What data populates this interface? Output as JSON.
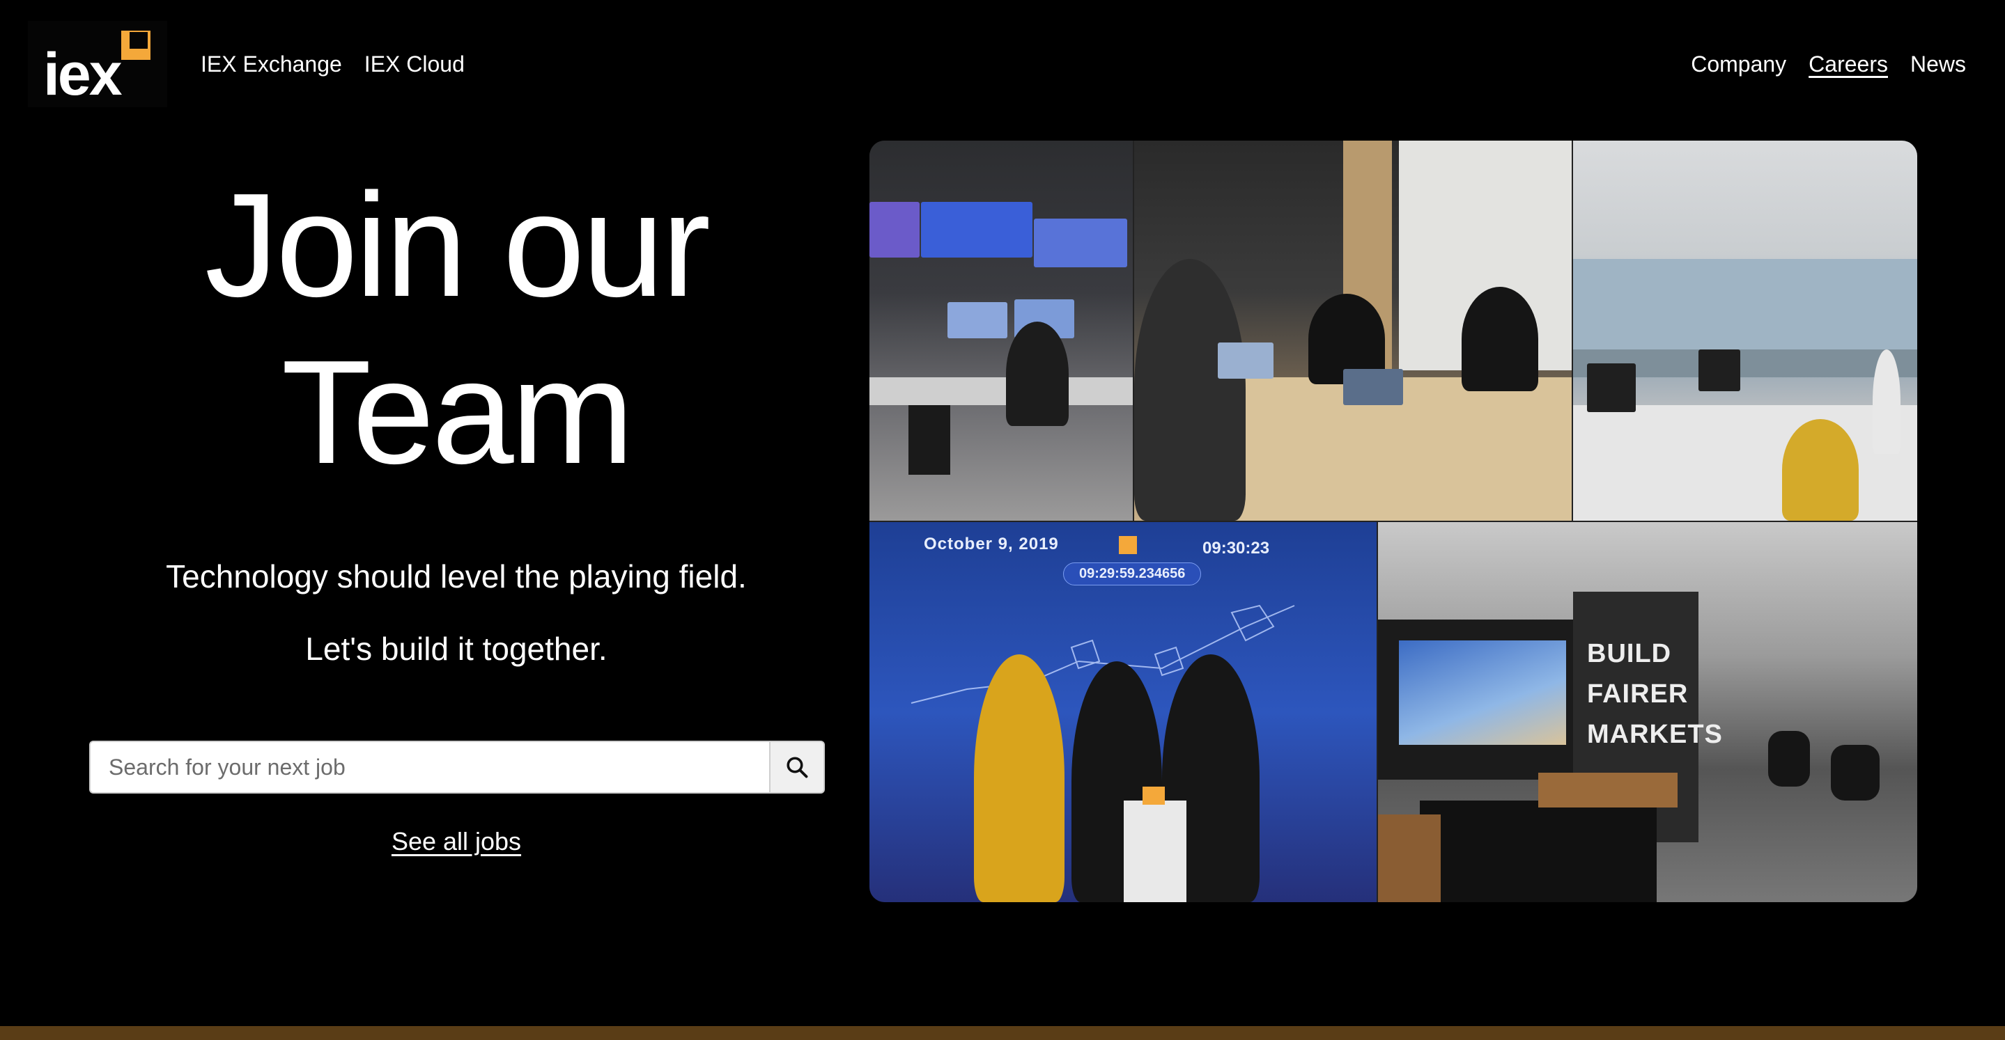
{
  "brand": {
    "logo_text": "iex",
    "accent": "#f4a83a"
  },
  "nav": {
    "left": [
      {
        "label": "IEX Exchange"
      },
      {
        "label": "IEX Cloud"
      }
    ],
    "right": [
      {
        "label": "Company"
      },
      {
        "label": "Careers",
        "active": true
      },
      {
        "label": "News"
      }
    ]
  },
  "hero": {
    "title_line1": "Join our",
    "title_line2": "Team",
    "tagline": "Technology should level the playing field.",
    "tagline2": "Let's build it together."
  },
  "search": {
    "placeholder": "Search for your next job",
    "icon": "search-icon"
  },
  "see_all": "See all jobs",
  "collage": {
    "photo4": {
      "date": "October 9, 2019",
      "timestamp": "09:29:59.234656",
      "time": "09:30:23"
    },
    "photo5": {
      "wall_line1": "BUILD",
      "wall_line2": "FAIRER",
      "wall_line3": "MARKETS"
    }
  }
}
